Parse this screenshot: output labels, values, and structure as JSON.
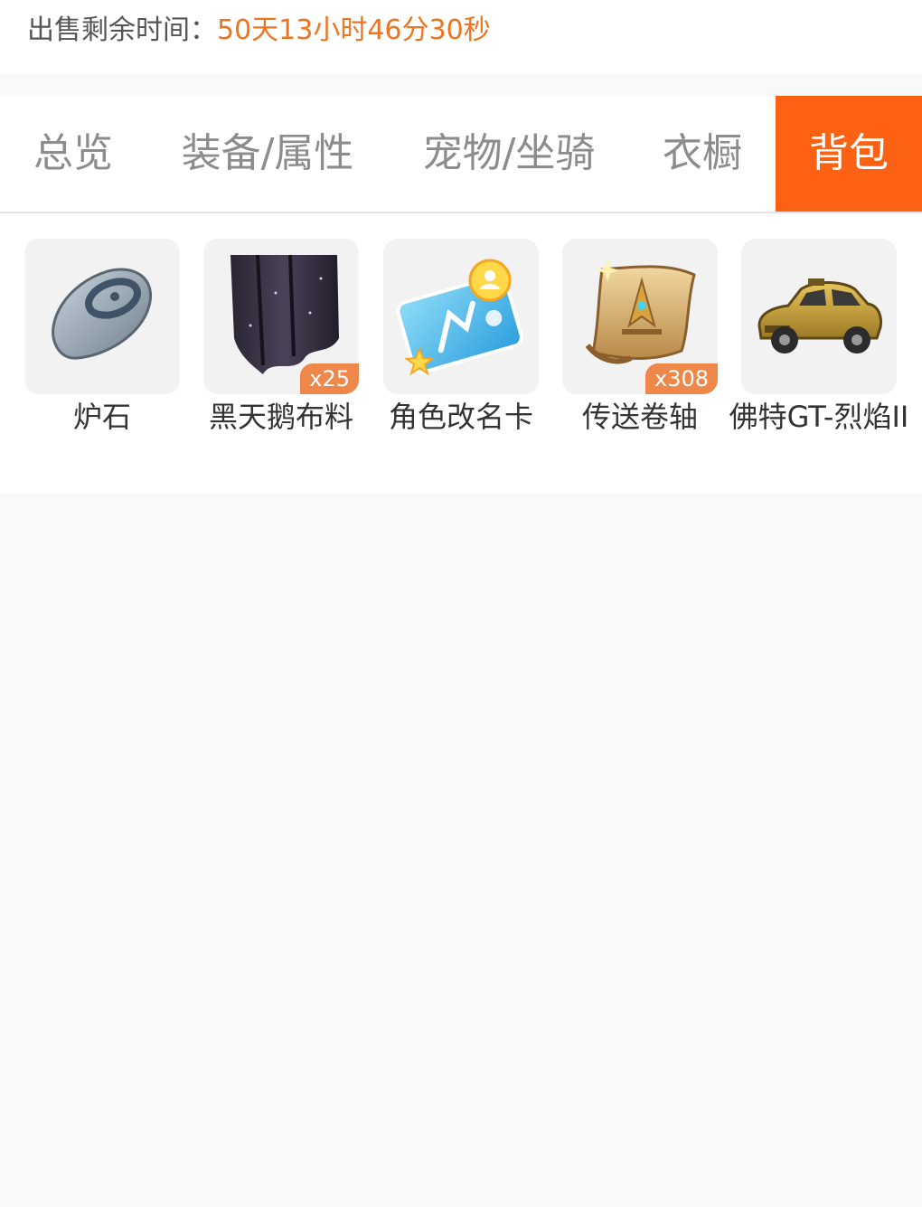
{
  "sale": {
    "label": "出售剩余时间：",
    "time": "50天13小时46分30秒"
  },
  "tabs": [
    {
      "label": "总览"
    },
    {
      "label": "装备/属性"
    },
    {
      "label": "宠物/坐骑"
    },
    {
      "label": "衣橱"
    },
    {
      "label": "背包",
      "active": true
    }
  ],
  "items": [
    {
      "name": "炉石",
      "icon": "hearthstone-icon",
      "qty": ""
    },
    {
      "name": "黑天鹅布料",
      "icon": "black-cloth-icon",
      "qty": "x25"
    },
    {
      "name": "角色改名卡",
      "icon": "rename-card-icon",
      "qty": ""
    },
    {
      "name": "传送卷轴",
      "icon": "teleport-scroll-icon",
      "qty": "x308"
    },
    {
      "name": "佛特GT-烈焰II",
      "icon": "vintage-car-icon",
      "qty": ""
    }
  ],
  "colors": {
    "accent": "#fd6114",
    "time": "#ee7420",
    "badge": "#f0874a"
  }
}
